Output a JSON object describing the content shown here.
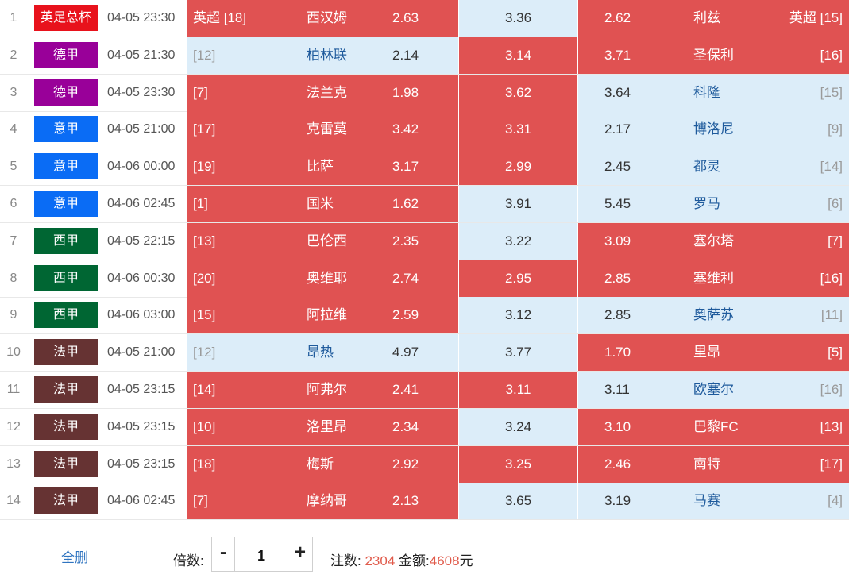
{
  "colors": {
    "selected": "#e05252",
    "unselected": "#dcedf9",
    "league": {
      "英足总杯": "#e8121c",
      "德甲": "#990099",
      "意甲": "#0a6cf5",
      "西甲": "#006633",
      "法甲": "#663333"
    }
  },
  "matches": [
    {
      "idx": "1",
      "league": "英足总杯",
      "time": "04-05 23:30",
      "home_rank": "英超 [18]",
      "home": "西汉姆",
      "home_odds": "2.63",
      "draw_odds": "3.36",
      "away_odds": "2.62",
      "away": "利兹",
      "away_rank": "英超 [15]",
      "home_sel": true,
      "draw_sel": false,
      "away_sel": true
    },
    {
      "idx": "2",
      "league": "德甲",
      "time": "04-05 21:30",
      "home_rank": "[12]",
      "home": "柏林联",
      "home_odds": "2.14",
      "draw_odds": "3.14",
      "away_odds": "3.71",
      "away": "圣保利",
      "away_rank": "[16]",
      "home_sel": false,
      "draw_sel": true,
      "away_sel": true
    },
    {
      "idx": "3",
      "league": "德甲",
      "time": "04-05 23:30",
      "home_rank": "[7]",
      "home": "法兰克",
      "home_odds": "1.98",
      "draw_odds": "3.62",
      "away_odds": "3.64",
      "away": "科隆",
      "away_rank": "[15]",
      "home_sel": true,
      "draw_sel": true,
      "away_sel": false
    },
    {
      "idx": "4",
      "league": "意甲",
      "time": "04-05 21:00",
      "home_rank": "[17]",
      "home": "克雷莫",
      "home_odds": "3.42",
      "draw_odds": "3.31",
      "away_odds": "2.17",
      "away": "博洛尼",
      "away_rank": "[9]",
      "home_sel": true,
      "draw_sel": true,
      "away_sel": false
    },
    {
      "idx": "5",
      "league": "意甲",
      "time": "04-06 00:00",
      "home_rank": "[19]",
      "home": "比萨",
      "home_odds": "3.17",
      "draw_odds": "2.99",
      "away_odds": "2.45",
      "away": "都灵",
      "away_rank": "[14]",
      "home_sel": true,
      "draw_sel": true,
      "away_sel": false
    },
    {
      "idx": "6",
      "league": "意甲",
      "time": "04-06 02:45",
      "home_rank": "[1]",
      "home": "国米",
      "home_odds": "1.62",
      "draw_odds": "3.91",
      "away_odds": "5.45",
      "away": "罗马",
      "away_rank": "[6]",
      "home_sel": true,
      "draw_sel": false,
      "away_sel": false
    },
    {
      "idx": "7",
      "league": "西甲",
      "time": "04-05 22:15",
      "home_rank": "[13]",
      "home": "巴伦西",
      "home_odds": "2.35",
      "draw_odds": "3.22",
      "away_odds": "3.09",
      "away": "塞尔塔",
      "away_rank": "[7]",
      "home_sel": true,
      "draw_sel": false,
      "away_sel": true
    },
    {
      "idx": "8",
      "league": "西甲",
      "time": "04-06 00:30",
      "home_rank": "[20]",
      "home": "奥维耶",
      "home_odds": "2.74",
      "draw_odds": "2.95",
      "away_odds": "2.85",
      "away": "塞维利",
      "away_rank": "[16]",
      "home_sel": true,
      "draw_sel": true,
      "away_sel": true
    },
    {
      "idx": "9",
      "league": "西甲",
      "time": "04-06 03:00",
      "home_rank": "[15]",
      "home": "阿拉维",
      "home_odds": "2.59",
      "draw_odds": "3.12",
      "away_odds": "2.85",
      "away": "奥萨苏",
      "away_rank": "[11]",
      "home_sel": true,
      "draw_sel": false,
      "away_sel": false
    },
    {
      "idx": "10",
      "league": "法甲",
      "time": "04-05 21:00",
      "home_rank": "[12]",
      "home": "昂热",
      "home_odds": "4.97",
      "draw_odds": "3.77",
      "away_odds": "1.70",
      "away": "里昂",
      "away_rank": "[5]",
      "home_sel": false,
      "draw_sel": false,
      "away_sel": true
    },
    {
      "idx": "11",
      "league": "法甲",
      "time": "04-05 23:15",
      "home_rank": "[14]",
      "home": "阿弗尔",
      "home_odds": "2.41",
      "draw_odds": "3.11",
      "away_odds": "3.11",
      "away": "欧塞尔",
      "away_rank": "[16]",
      "home_sel": true,
      "draw_sel": true,
      "away_sel": false
    },
    {
      "idx": "12",
      "league": "法甲",
      "time": "04-05 23:15",
      "home_rank": "[10]",
      "home": "洛里昂",
      "home_odds": "2.34",
      "draw_odds": "3.24",
      "away_odds": "3.10",
      "away": "巴黎FC",
      "away_rank": "[13]",
      "home_sel": true,
      "draw_sel": false,
      "away_sel": true
    },
    {
      "idx": "13",
      "league": "法甲",
      "time": "04-05 23:15",
      "home_rank": "[18]",
      "home": "梅斯",
      "home_odds": "2.92",
      "draw_odds": "3.25",
      "away_odds": "2.46",
      "away": "南特",
      "away_rank": "[17]",
      "home_sel": true,
      "draw_sel": true,
      "away_sel": true
    },
    {
      "idx": "14",
      "league": "法甲",
      "time": "04-06 02:45",
      "home_rank": "[7]",
      "home": "摩纳哥",
      "home_odds": "2.13",
      "draw_odds": "3.65",
      "away_odds": "3.19",
      "away": "马赛",
      "away_rank": "[4]",
      "home_sel": true,
      "draw_sel": false,
      "away_sel": false
    }
  ],
  "footer": {
    "clear_label": "全删",
    "multiplier_label": "倍数:",
    "minus": "-",
    "multiplier_value": "1",
    "plus": "+",
    "bets_label": "注数:",
    "bets_value": "2304",
    "amount_label": "金额:",
    "amount_value": "4608",
    "currency": "元"
  }
}
